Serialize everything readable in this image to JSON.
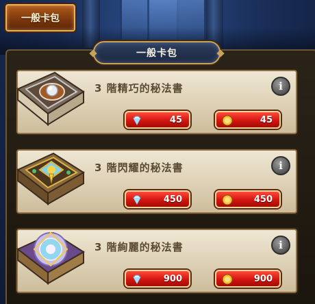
{
  "tab": {
    "label": "一般卡包"
  },
  "header": {
    "title": "一般卡包"
  },
  "packs": [
    {
      "name": "3 階精巧的秘法書",
      "gem_price": "45",
      "gold_price": "45",
      "book_style": "silver-orb"
    },
    {
      "name": "3 階閃耀的秘法書",
      "gem_price": "450",
      "gold_price": "450",
      "book_style": "gold-shield"
    },
    {
      "name": "3 階絢麗的秘法書",
      "gem_price": "900",
      "gold_price": "900",
      "book_style": "prismatic-emblem"
    }
  ],
  "icons": {
    "info": "info-icon",
    "gem": "diamond-icon",
    "gold": "gold-coin-icon"
  },
  "colors": {
    "price_button": "#d3150f",
    "tab_accent": "#b05a1a",
    "card_bg": "#efe7d4"
  }
}
